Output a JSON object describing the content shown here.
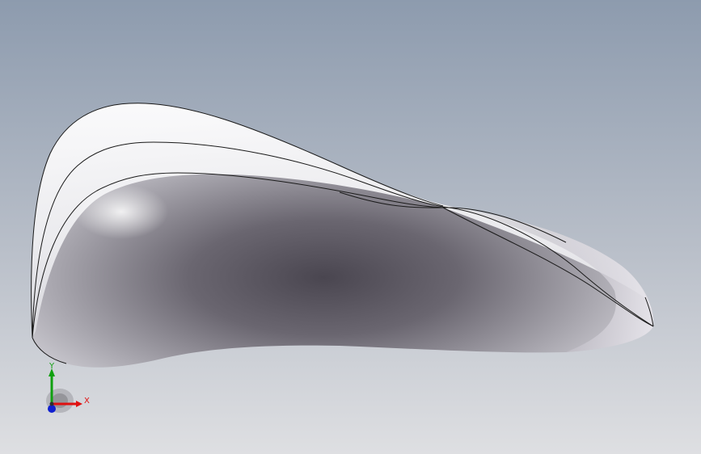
{
  "triad": {
    "x_label": "X",
    "y_label": "Y",
    "x_color": "#e01010",
    "y_color": "#10a010",
    "z_color": "#1020d0"
  },
  "background": {
    "top_color": "#8f9db0",
    "bottom_color": "#dcdde0"
  }
}
